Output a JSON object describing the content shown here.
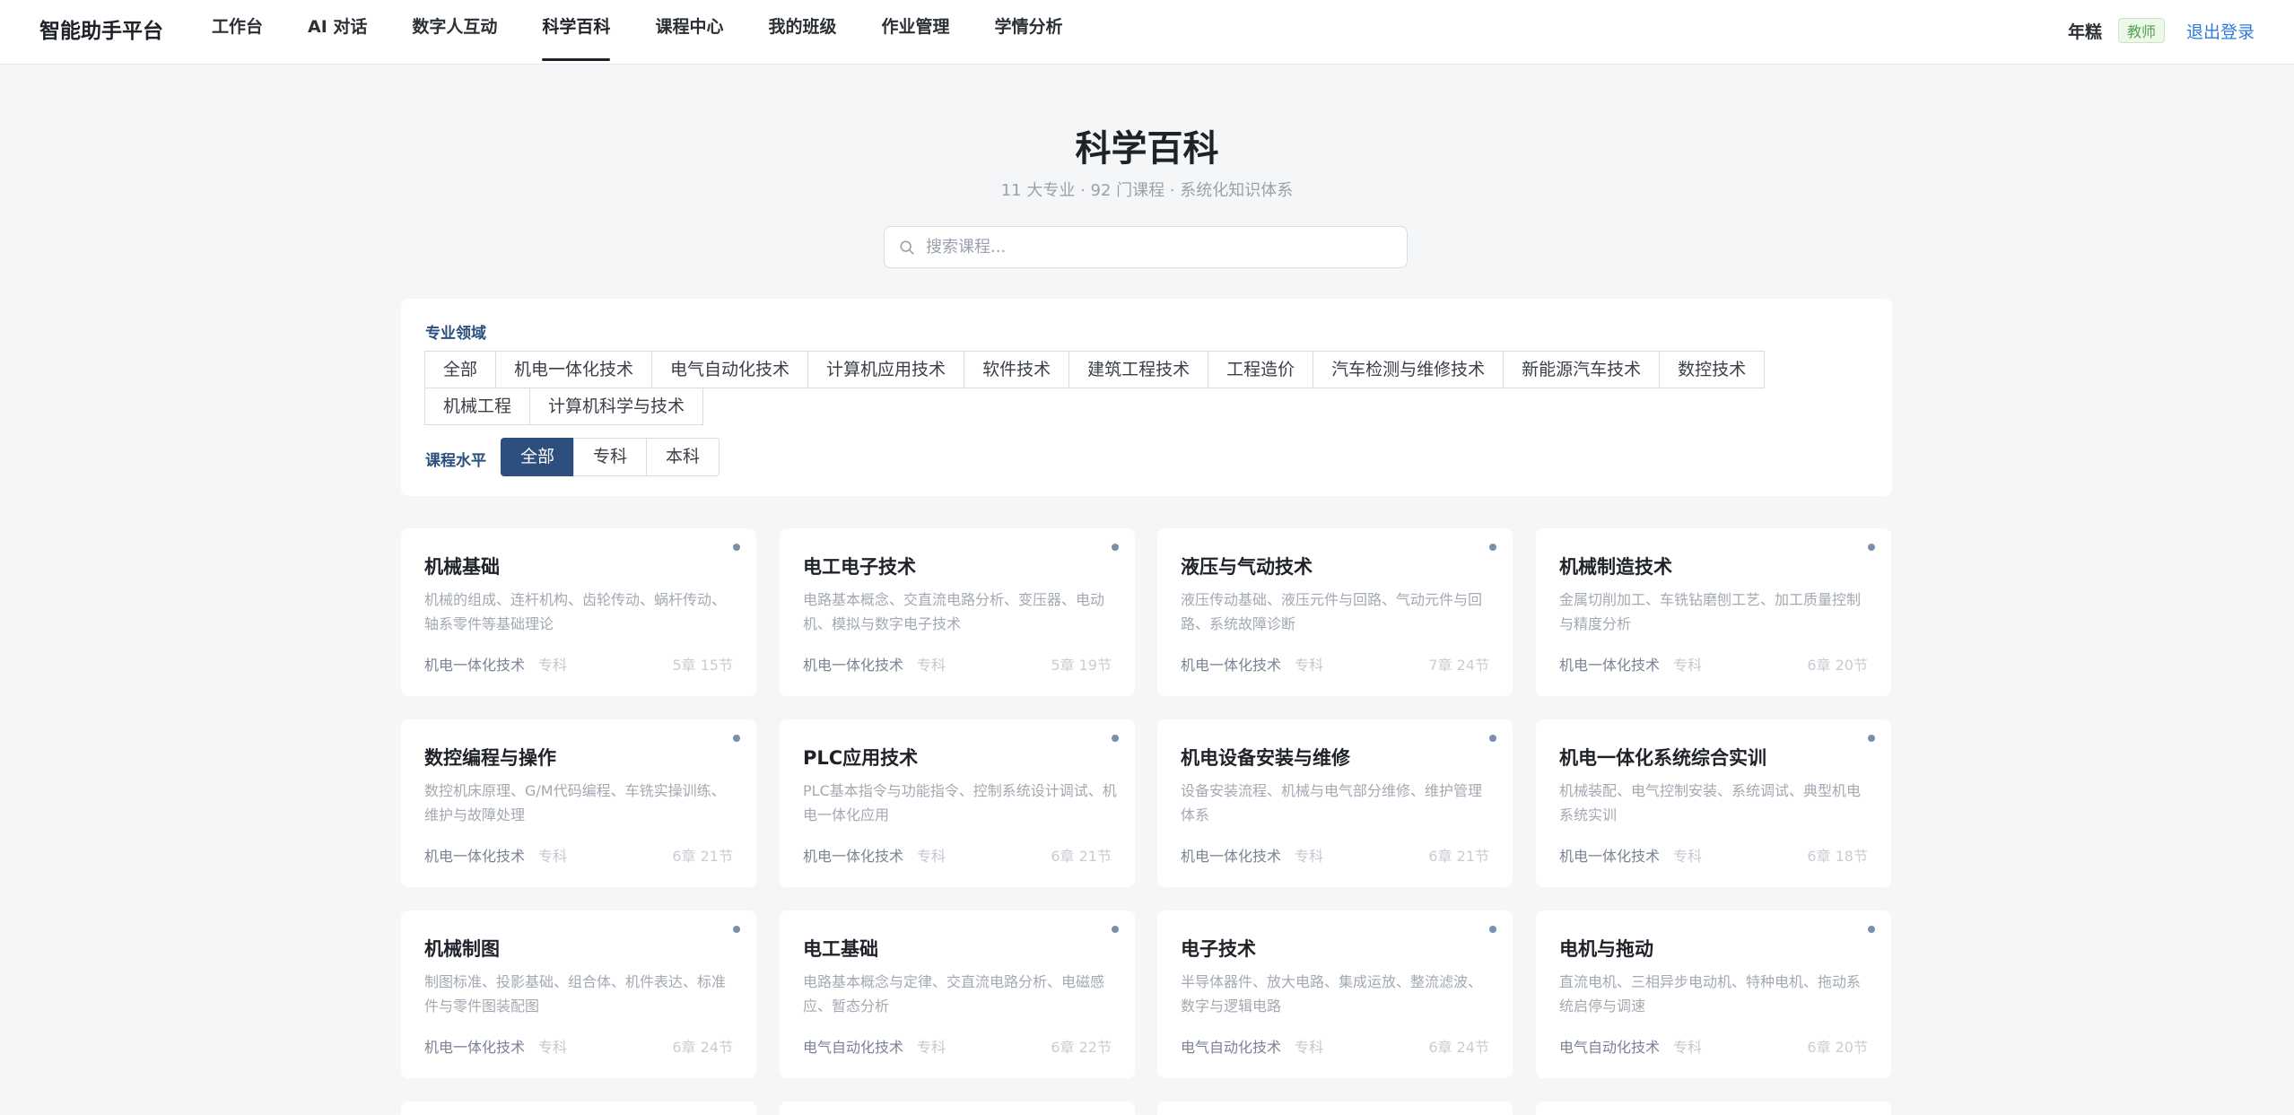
{
  "app": {
    "brand": "智能助手平台"
  },
  "nav": [
    {
      "label": "工作台"
    },
    {
      "label": "AI 对话"
    },
    {
      "label": "数字人互动"
    },
    {
      "label": "科学百科",
      "active": true
    },
    {
      "label": "课程中心"
    },
    {
      "label": "我的班级"
    },
    {
      "label": "作业管理"
    },
    {
      "label": "学情分析"
    }
  ],
  "user": {
    "name": "年糕",
    "role": "教师",
    "logout_label": "退出登录"
  },
  "hero": {
    "title": "科学百科",
    "subtitle": "11 大专业 · 92 门课程 · 系统化知识体系",
    "search_placeholder": "搜索课程..."
  },
  "filters": {
    "field_label": "专业领域",
    "fields": [
      "全部",
      "机电一体化技术",
      "电气自动化技术",
      "计算机应用技术",
      "软件技术",
      "建筑工程技术",
      "工程造价",
      "汽车检测与维修技术",
      "新能源汽车技术",
      "数控技术",
      "机械工程",
      "计算机科学与技术"
    ],
    "level_label": "课程水平",
    "levels": [
      "全部",
      "专科",
      "本科"
    ],
    "active_level": "全部"
  },
  "colors": {
    "accent": "#2c4f7e",
    "link": "#2f7bd9",
    "role_badge": "#52a352"
  },
  "courses": [
    {
      "title": "机械基础",
      "desc": "机械的组成、连杆机构、齿轮传动、蜗杆传动、轴系零件等基础理论",
      "major": "机电一体化技术",
      "level": "专科",
      "count": "5章 15节"
    },
    {
      "title": "电工电子技术",
      "desc": "电路基本概念、交直流电路分析、变压器、电动机、模拟与数字电子技术",
      "major": "机电一体化技术",
      "level": "专科",
      "count": "5章 19节"
    },
    {
      "title": "液压与气动技术",
      "desc": "液压传动基础、液压元件与回路、气动元件与回路、系统故障诊断",
      "major": "机电一体化技术",
      "level": "专科",
      "count": "7章 24节"
    },
    {
      "title": "机械制造技术",
      "desc": "金属切削加工、车铣钻磨刨工艺、加工质量控制与精度分析",
      "major": "机电一体化技术",
      "level": "专科",
      "count": "6章 20节"
    },
    {
      "title": "数控编程与操作",
      "desc": "数控机床原理、G/M代码编程、车铣实操训练、维护与故障处理",
      "major": "机电一体化技术",
      "level": "专科",
      "count": "6章 21节"
    },
    {
      "title": "PLC应用技术",
      "desc": "PLC基本指令与功能指令、控制系统设计调试、机电一体化应用",
      "major": "机电一体化技术",
      "level": "专科",
      "count": "6章 21节"
    },
    {
      "title": "机电设备安装与维修",
      "desc": "设备安装流程、机械与电气部分维修、维护管理体系",
      "major": "机电一体化技术",
      "level": "专科",
      "count": "6章 21节"
    },
    {
      "title": "机电一体化系统综合实训",
      "desc": "机械装配、电气控制安装、系统调试、典型机电系统实训",
      "major": "机电一体化技术",
      "level": "专科",
      "count": "6章 18节"
    },
    {
      "title": "机械制图",
      "desc": "制图标准、投影基础、组合体、机件表达、标准件与零件图装配图",
      "major": "机电一体化技术",
      "level": "专科",
      "count": "6章 24节"
    },
    {
      "title": "电工基础",
      "desc": "电路基本概念与定律、交直流电路分析、电磁感应、暂态分析",
      "major": "电气自动化技术",
      "level": "专科",
      "count": "6章 22节"
    },
    {
      "title": "电子技术",
      "desc": "半导体器件、放大电路、集成运放、整流滤波、数字与逻辑电路",
      "major": "电气自动化技术",
      "level": "专科",
      "count": "6章 24节"
    },
    {
      "title": "电机与拖动",
      "desc": "直流电机、三相异步电动机、特种电机、拖动系统启停与调速",
      "major": "电气自动化技术",
      "level": "专科",
      "count": "6章 20节"
    }
  ]
}
